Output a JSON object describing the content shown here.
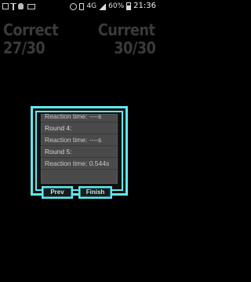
{
  "status_bar": {
    "icons": [
      "screenshot-icon",
      "usb-icon",
      "debug-icon",
      "mail-icon",
      "alarm-icon",
      "vibrate-icon",
      "signal-icon",
      "battery-icon"
    ],
    "network": "4G",
    "battery": "60%",
    "time": "21:36"
  },
  "score": {
    "correct_label": "Correct",
    "correct_value": "27/30",
    "current_label": "Current",
    "current_value": "30/30"
  },
  "results": {
    "lines": [
      "Reaction time: ----s",
      "Round 4:",
      "Reaction time: ----s",
      "Round 5:",
      "Reaction time: 0.544s"
    ]
  },
  "buttons": {
    "prev": "Prev",
    "finish": "Finish"
  },
  "colors": {
    "accent": "#5fe8ee",
    "panel": "#4a4a4a",
    "score_text": "#3a3a3a",
    "background": "#000000"
  }
}
